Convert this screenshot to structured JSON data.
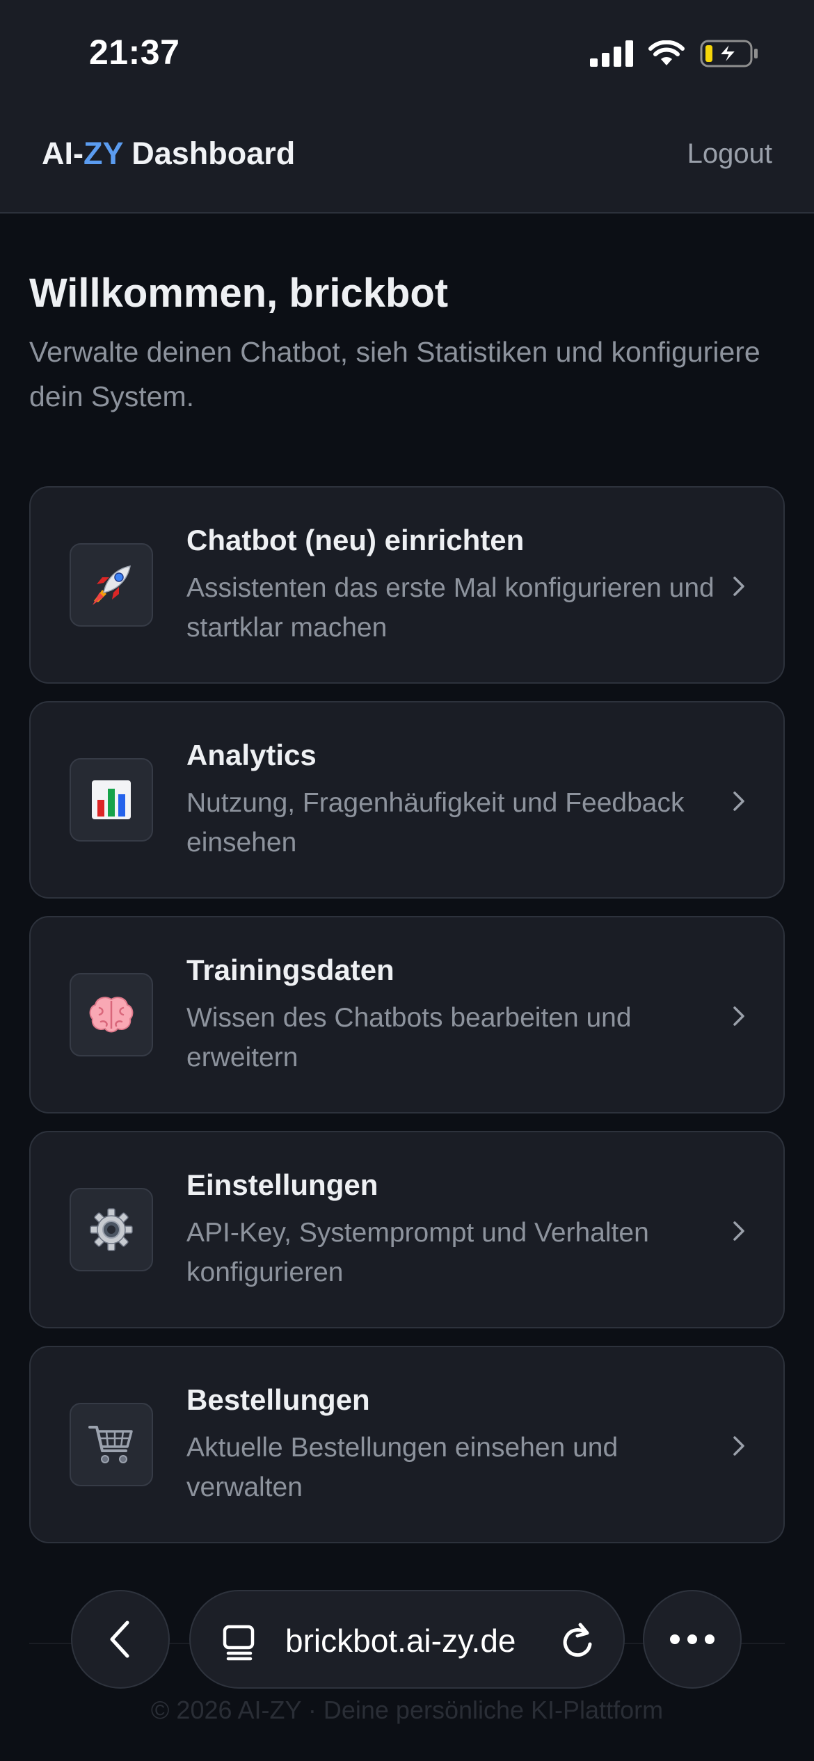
{
  "status_bar": {
    "time": "21:37",
    "icons": [
      "cellular-signal-icon",
      "wifi-icon",
      "battery-charging-icon"
    ]
  },
  "header": {
    "brand_prefix": "AI-",
    "brand_accent": "ZY",
    "brand_suffix": " Dashboard",
    "logout_label": "Logout"
  },
  "welcome": {
    "title": "Willkommen, brickbot",
    "subtitle": "Verwalte deinen Chatbot, sieh Statistiken und konfiguriere dein System."
  },
  "cards": [
    {
      "icon": "rocket-icon",
      "title": "Chatbot (neu) einrichten",
      "description": "Assistenten das erste Mal konfigurieren und startklar machen"
    },
    {
      "icon": "bar-chart-icon",
      "title": "Analytics",
      "description": "Nutzung, Fragenhäufigkeit und Feedback einsehen"
    },
    {
      "icon": "brain-icon",
      "title": "Trainingsdaten",
      "description": "Wissen des Chatbots bearbeiten und erweitern"
    },
    {
      "icon": "gear-icon",
      "title": "Einstellungen",
      "description": "API-Key, Systemprompt und Verhalten konfigurieren"
    },
    {
      "icon": "shopping-cart-icon",
      "title": "Bestellungen",
      "description": "Aktuelle Bestellungen einsehen und verwalten"
    }
  ],
  "footer": {
    "text": "© 2026 AI-ZY · Deine persönliche KI-Plattform"
  },
  "browser": {
    "url": "brickbot.ai-zy.de"
  },
  "colors": {
    "background": "#0c0f15",
    "surface": "#1a1d25",
    "accent": "#5b9cf0",
    "muted_text": "#8d939d"
  }
}
